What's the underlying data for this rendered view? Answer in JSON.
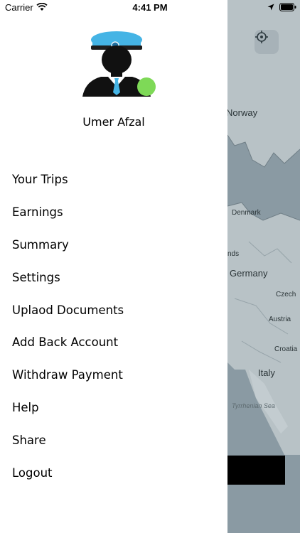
{
  "status_bar": {
    "carrier": "Carrier",
    "time": "4:41 PM"
  },
  "user": {
    "name": "Umer Afzal",
    "online_color": "#7ed957"
  },
  "menu": {
    "items": [
      {
        "label": "Your Trips"
      },
      {
        "label": "Earnings"
      },
      {
        "label": "Summary"
      },
      {
        "label": "Settings"
      },
      {
        "label": "Uplaod Documents"
      },
      {
        "label": "Add Back Account"
      },
      {
        "label": "Withdraw Payment"
      },
      {
        "label": "Help"
      },
      {
        "label": "Share"
      },
      {
        "label": "Logout"
      }
    ]
  },
  "map": {
    "labels": {
      "norway": "Norway",
      "denmark": "Denmark",
      "netherlands_partial": "nds",
      "germany": "Germany",
      "czech_partial": "Czech",
      "austria": "Austria",
      "croatia": "Croatia",
      "italy": "Italy",
      "sea_partial": "Tyrrhenian Sea"
    }
  }
}
